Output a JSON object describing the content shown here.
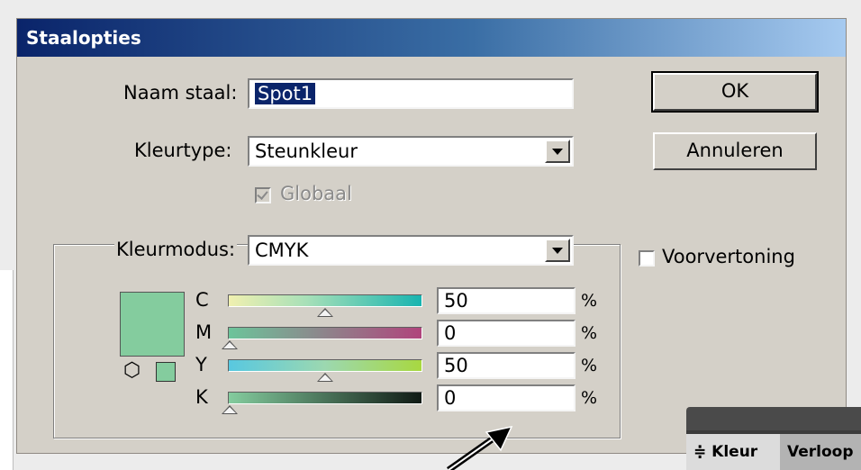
{
  "dialog": {
    "title": "Staalopties",
    "name_label": "Naam staal:",
    "name_value": "Spot1",
    "colortype_label": "Kleurtype:",
    "colortype_value": "Steunkleur",
    "global_label": "Globaal",
    "colormode_label": "Kleurmodus:",
    "colormode_value": "CMYK",
    "ok_label": "OK",
    "cancel_label": "Annuleren",
    "preview_label": "Voorvertoning",
    "swatch_color": "#84cc9e",
    "channels": [
      {
        "label": "C",
        "value": "50",
        "unit": "%"
      },
      {
        "label": "M",
        "value": "0",
        "unit": "%"
      },
      {
        "label": "Y",
        "value": "50",
        "unit": "%"
      },
      {
        "label": "K",
        "value": "0",
        "unit": "%"
      }
    ]
  },
  "panel": {
    "tab_active": "≑ Kleur",
    "tab_inactive": "Verloop"
  }
}
